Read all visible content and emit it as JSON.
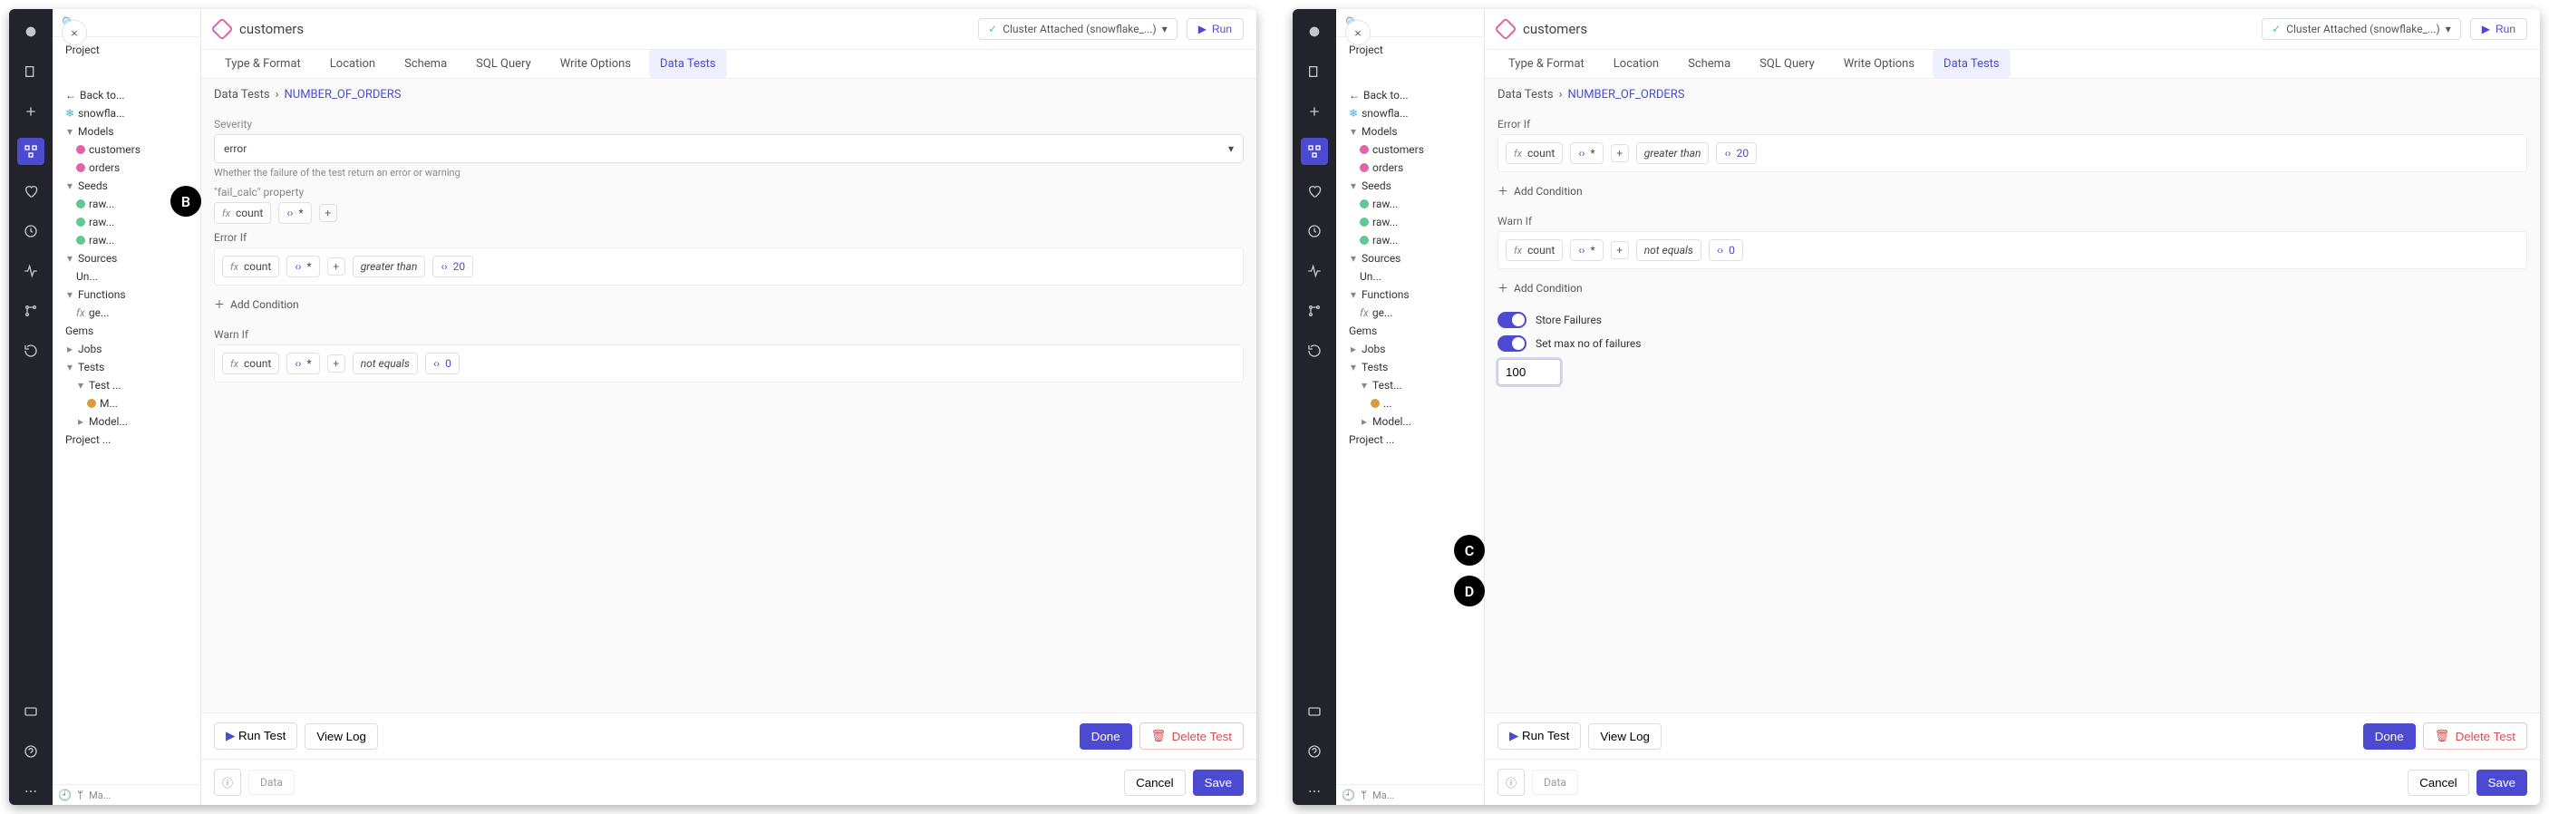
{
  "global": {
    "project": "Project",
    "cluster_status": "Cluster Attached (snowflake_...)",
    "run_label": "Run",
    "title": "customers",
    "close_label": "×",
    "tabs": [
      "Type & Format",
      "Location",
      "Schema",
      "SQL Query",
      "Write Options",
      "Data Tests"
    ],
    "active_tab": 5,
    "breadcrumb_root": "Data Tests",
    "breadcrumb_leaf": "NUMBER_OF_ORDERS",
    "run_test": "Run Test",
    "view_log": "View Log",
    "done": "Done",
    "delete_test": "Delete Test",
    "cancel": "Cancel",
    "save": "Save",
    "data_pill": "Data",
    "add_condition": "Add Condition"
  },
  "tree": {
    "models_label": "Models",
    "models_item1": "customers",
    "models_item2": "orders",
    "seeds_label": "Seeds",
    "seeds_item1": "raw...",
    "seeds_item2": "raw...",
    "seeds_item3": "raw...",
    "sources_label": "Sources",
    "sources_item1": "Un...",
    "functions_label": "Functions",
    "functions_item1": "ge...",
    "gems_label": "Gems",
    "jobs_label": "Jobs",
    "tests_label": "Tests",
    "tests_item1": "Test ...",
    "tests_item1_child": "M...",
    "model_tests_label": "Model...",
    "project_conf": "Project ..."
  },
  "left": {
    "severity_label": "Severity",
    "severity_value": "error",
    "severity_help": "Whether the failure of the test return an error or warning",
    "failcalc_label": "\"fail_calc\" property",
    "failcalc_fx": "count",
    "failcalc_star": "*",
    "error_if_label": "Error If",
    "error_fx": "count",
    "error_star": "*",
    "error_op": "greater than",
    "error_val": "20",
    "warn_if_label": "Warn If",
    "warn_fx": "count",
    "warn_star": "*",
    "warn_op": "not equals",
    "warn_val": "0"
  },
  "right": {
    "error_if_label": "Error If",
    "error_fx": "count",
    "error_star": "*",
    "error_op": "greater than",
    "error_val": "20",
    "warn_if_label": "Warn If",
    "warn_fx": "count",
    "warn_star": "*",
    "warn_op": "not equals",
    "warn_val": "0",
    "store_failures": "Store Failures",
    "set_max_failures": "Set max no of failures",
    "max_failures_value": "100"
  },
  "footer_branch": "Ma..."
}
